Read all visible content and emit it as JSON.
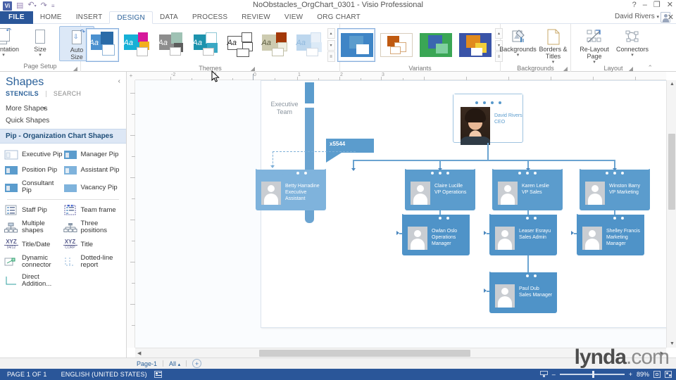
{
  "titlebar": {
    "doc_title": "NoObstacles_OrgChart_0301 - Visio Professional",
    "qat": [
      {
        "name": "visio-logo",
        "label": "Vi"
      },
      {
        "name": "save-icon",
        "label": "▤"
      },
      {
        "name": "undo-icon",
        "label": "↶"
      },
      {
        "name": "redo-icon",
        "label": "↷"
      },
      {
        "name": "qat-customize-icon",
        "label": "≡"
      }
    ],
    "window_buttons": [
      {
        "name": "help-button",
        "label": "?"
      },
      {
        "name": "minimize-button",
        "label": "–"
      },
      {
        "name": "restore-button",
        "label": "❐"
      },
      {
        "name": "close-button",
        "label": "✕"
      }
    ]
  },
  "tabs": [
    {
      "label": "FILE",
      "key": "file"
    },
    {
      "label": "HOME",
      "key": "home"
    },
    {
      "label": "INSERT",
      "key": "insert"
    },
    {
      "label": "DESIGN",
      "key": "design",
      "active": true
    },
    {
      "label": "DATA",
      "key": "data"
    },
    {
      "label": "PROCESS",
      "key": "process"
    },
    {
      "label": "REVIEW",
      "key": "review"
    },
    {
      "label": "VIEW",
      "key": "view"
    },
    {
      "label": "ORG CHART",
      "key": "orgchart"
    }
  ],
  "account": {
    "user_name": "David Rivers",
    "dropdown": "▾",
    "close_label": "✕"
  },
  "ribbon": {
    "groups": [
      {
        "name": "page-setup",
        "label": "Page Setup",
        "buttons": [
          {
            "label": "Orientation",
            "arrow": "▾",
            "icon": "orientation-icon"
          },
          {
            "label": "Size",
            "arrow": "▾",
            "icon": "size-icon"
          },
          {
            "label": "Auto\nSize",
            "arrow": "",
            "icon": "auto-size-icon",
            "selected": true
          }
        ]
      },
      {
        "name": "themes",
        "label": "Themes"
      },
      {
        "name": "variants",
        "label": "Variants"
      },
      {
        "name": "backgrounds",
        "label": "Backgrounds",
        "buttons": [
          {
            "label": "Backgrounds",
            "arrow": "▾",
            "icon": "backgrounds-icon"
          },
          {
            "label": "Borders &\nTitles",
            "arrow": "▾",
            "icon": "borders-titles-icon"
          }
        ]
      },
      {
        "name": "layout",
        "label": "Layout",
        "buttons": [
          {
            "label": "Re-Layout\nPage",
            "arrow": "▾",
            "icon": "re-layout-page-icon"
          },
          {
            "label": "Connectors",
            "arrow": "▾",
            "icon": "connectors-icon"
          }
        ]
      }
    ],
    "themes": [
      {
        "name": "theme-office",
        "selected": true,
        "aa": "#2e75b6",
        "c1": "#4a90cf",
        "c2": "#2a6ba8",
        "c3": "#ffffff"
      },
      {
        "name": "theme-vivid",
        "selected": false,
        "aa": "#17b0d6",
        "c1": "#17b0d6",
        "c2": "#d6189b",
        "c3": "#f2b01e"
      },
      {
        "name": "theme-grey",
        "selected": false,
        "aa": "#7d7d7d",
        "c1": "#8d8d8d",
        "c2": "#9fc2b4",
        "c3": "#5d5d5d"
      },
      {
        "name": "theme-teal",
        "selected": false,
        "aa": "#1d93ad",
        "c1": "#1d93ad",
        "c2": "#ffffff",
        "c3": "#3aa8c4"
      },
      {
        "name": "theme-white",
        "selected": false,
        "aa": "#222222",
        "c1": "#ffffff",
        "c2": "#ffffff",
        "c3": "#ffffff"
      },
      {
        "name": "theme-sand",
        "selected": false,
        "aa": "#6f7153",
        "c1": "#cdcbb0",
        "c2": "#a33808",
        "c3": "#efeee2"
      },
      {
        "name": "theme-pale",
        "selected": false,
        "aa": "#9dc3e6",
        "c1": "#bdd7ee",
        "c2": "#eaf1f9",
        "c3": "#ffffff"
      }
    ],
    "variants": [
      {
        "name": "variant-blue",
        "selected": true,
        "c1": "#3f85c6",
        "c2": "#5b9ccd",
        "c3": "#ffffff"
      },
      {
        "name": "variant-orange",
        "selected": false,
        "c1": "#ffffff",
        "c2": "#c05a10",
        "c3": "#e8c9a8"
      },
      {
        "name": "variant-green",
        "selected": false,
        "c1": "#3aa655",
        "c2": "#3a66b0",
        "c3": "#7fd0a0"
      },
      {
        "name": "variant-royal",
        "selected": false,
        "c1": "#3a54a8",
        "c2": "#e08a1e",
        "c3": "#f2cf3a"
      }
    ],
    "gallery_nav": [
      "▴",
      "▾",
      "≡"
    ],
    "dialog_launcher": "◢",
    "collapse_ribbon": "⌃"
  },
  "shapes_pane": {
    "title": "Shapes",
    "collapse_icon": "‹",
    "tabs": [
      {
        "label": "STENCILS",
        "active": true
      },
      {
        "label": "SEARCH",
        "active": false
      }
    ],
    "links": [
      {
        "label": "More Shapes",
        "chevron": "▸"
      },
      {
        "label": "Quick Shapes",
        "chevron": ""
      }
    ],
    "stencil_title": "Pip - Organization Chart Shapes",
    "items": [
      {
        "label": "Executive Pip",
        "icon": "executive-pip-icon"
      },
      {
        "label": "Manager Pip",
        "icon": "manager-pip-icon"
      },
      {
        "label": "Position Pip",
        "icon": "position-pip-icon"
      },
      {
        "label": "Assistant Pip",
        "icon": "assistant-pip-icon"
      },
      {
        "label": "Consultant Pip",
        "icon": "consultant-pip-icon"
      },
      {
        "label": "Vacancy Pip",
        "icon": "vacancy-pip-icon"
      },
      {
        "label": "Staff Pip",
        "icon": "staff-pip-icon"
      },
      {
        "label": "Team frame",
        "icon": "team-frame-icon"
      },
      {
        "label": "Multiple shapes",
        "icon": "multiple-shapes-icon"
      },
      {
        "label": "Three positions",
        "icon": "three-positions-icon"
      },
      {
        "label": "Title/Date",
        "icon": "title-date-icon",
        "glyph": "XYZ",
        "sub": "04/12"
      },
      {
        "label": "Title",
        "icon": "title-icon",
        "glyph": "XYZ",
        "sub": "CORP"
      },
      {
        "label": "Dynamic connector",
        "icon": "dynamic-connector-icon"
      },
      {
        "label": "Dotted-line report",
        "icon": "dotted-line-report-icon"
      },
      {
        "label": "Direct Addition...",
        "icon": "direct-addition-icon"
      }
    ]
  },
  "canvas": {
    "h_ruler_labels": [
      "-2",
      "-1",
      "0",
      "1",
      "2",
      "3"
    ],
    "team_frame_label": "Executive\nTeam",
    "callout": "x5544",
    "nodes": [
      {
        "id": "ceo",
        "name": "David Rivers",
        "title": "CEO",
        "style": "photo",
        "dots": 4
      },
      {
        "id": "assistant",
        "name": "Betty Harradine",
        "title": "Executive Assistant",
        "style": "light",
        "dots": 2
      },
      {
        "id": "vp-ops",
        "name": "Claire Lucille",
        "title": "VP Operations",
        "style": "mid",
        "dots": 3
      },
      {
        "id": "vp-sales",
        "name": "Karen Leslie",
        "title": "VP Sales",
        "style": "mid",
        "dots": 3
      },
      {
        "id": "vp-marketing",
        "name": "Winston Barry",
        "title": "VP Marketing",
        "style": "mid",
        "dots": 3
      },
      {
        "id": "ops-manager",
        "name": "Owlan Oslo",
        "title": "Operations Manager",
        "style": "normal",
        "dots": 2
      },
      {
        "id": "sales-admin",
        "name": "Leaser Esrayu",
        "title": "Sales Admin",
        "style": "normal",
        "dots": 2
      },
      {
        "id": "marketing-manager",
        "name": "Shelley Francis",
        "title": "Marketing Manager",
        "style": "normal",
        "dots": 2
      },
      {
        "id": "sales-manager",
        "name": "Paul Dub",
        "title": "Sales Manager",
        "style": "normal",
        "dots": 2
      }
    ]
  },
  "page_tabs": {
    "pages": [
      {
        "label": "Page-1",
        "active": true
      }
    ],
    "all_label": "All",
    "all_arrow": "▴",
    "add_page": "+"
  },
  "status_bar": {
    "page_count": "PAGE 1 OF 1",
    "language": "ENGLISH (UNITED STATES)",
    "macro_icon": "macro-recording-icon",
    "zoom_percent": "89%",
    "zoom_out": "–",
    "zoom_in": "+",
    "fit_page_icon": "fit-page-icon",
    "full_screen_icon": "full-screen-icon",
    "presentation_icon": "presentation-mode-icon"
  },
  "watermark": {
    "bold": "lynda",
    "light": ".com"
  }
}
